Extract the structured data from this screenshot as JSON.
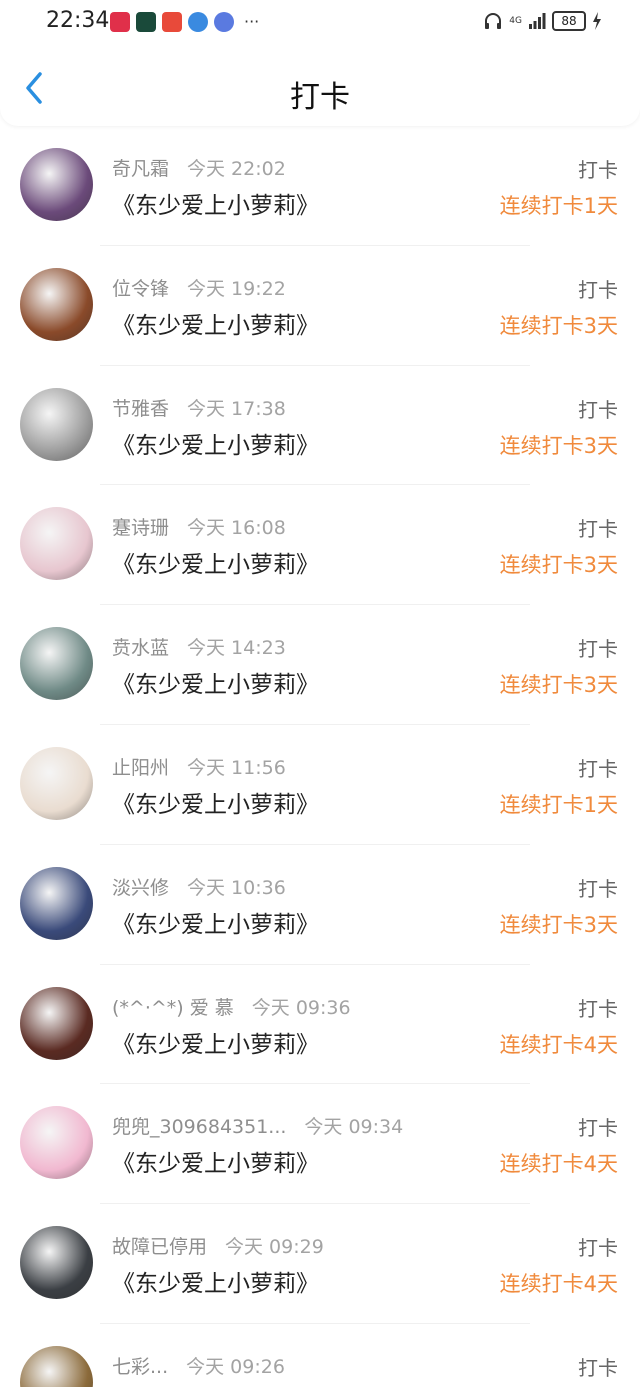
{
  "status_bar": {
    "time": "22:34",
    "more": "···",
    "network": "4G",
    "battery": "88"
  },
  "header": {
    "title": "打卡"
  },
  "items": [
    {
      "name": "奇凡霜",
      "time": "今天 22:02",
      "book": "《东少爱上小萝莉》",
      "action": "打卡",
      "streak": "连续打卡1天",
      "avatar_color": "#6b4a7a"
    },
    {
      "name": "位令锋",
      "time": "今天 19:22",
      "book": "《东少爱上小萝莉》",
      "action": "打卡",
      "streak": "连续打卡3天",
      "avatar_color": "#8a4a2a"
    },
    {
      "name": "节雅香",
      "time": "今天 17:38",
      "book": "《东少爱上小萝莉》",
      "action": "打卡",
      "streak": "连续打卡3天",
      "avatar_color": "#9c9c9c"
    },
    {
      "name": "蹇诗珊",
      "time": "今天 16:08",
      "book": "《东少爱上小萝莉》",
      "action": "打卡",
      "streak": "连续打卡3天",
      "avatar_color": "#e7c6cf"
    },
    {
      "name": "贲水蓝",
      "time": "今天 14:23",
      "book": "《东少爱上小萝莉》",
      "action": "打卡",
      "streak": "连续打卡3天",
      "avatar_color": "#6f8a86"
    },
    {
      "name": "止阳州",
      "time": "今天 11:56",
      "book": "《东少爱上小萝莉》",
      "action": "打卡",
      "streak": "连续打卡1天",
      "avatar_color": "#e9dcd0"
    },
    {
      "name": "淡兴修",
      "time": "今天 10:36",
      "book": "《东少爱上小萝莉》",
      "action": "打卡",
      "streak": "连续打卡3天",
      "avatar_color": "#3a4a7a"
    },
    {
      "name": "(*^·^*) 爱 慕",
      "time": "今天 09:36",
      "book": "《东少爱上小萝莉》",
      "action": "打卡",
      "streak": "连续打卡4天",
      "avatar_color": "#5a2a22"
    },
    {
      "name": "兜兜_309684351...",
      "time": "今天 09:34",
      "book": "《东少爱上小萝莉》",
      "action": "打卡",
      "streak": "连续打卡4天",
      "avatar_color": "#f1b8d0"
    },
    {
      "name": "故障已停用",
      "time": "今天 09:29",
      "book": "《东少爱上小萝莉》",
      "action": "打卡",
      "streak": "连续打卡4天",
      "avatar_color": "#3b3f44"
    },
    {
      "name": "七彩...",
      "time": "今天 09:26",
      "book": "",
      "action": "打卡",
      "streak": "",
      "avatar_color": "#8b6a3a"
    }
  ],
  "colors": {
    "accent": "#f08a3c",
    "back_arrow": "#2a8fe0"
  }
}
